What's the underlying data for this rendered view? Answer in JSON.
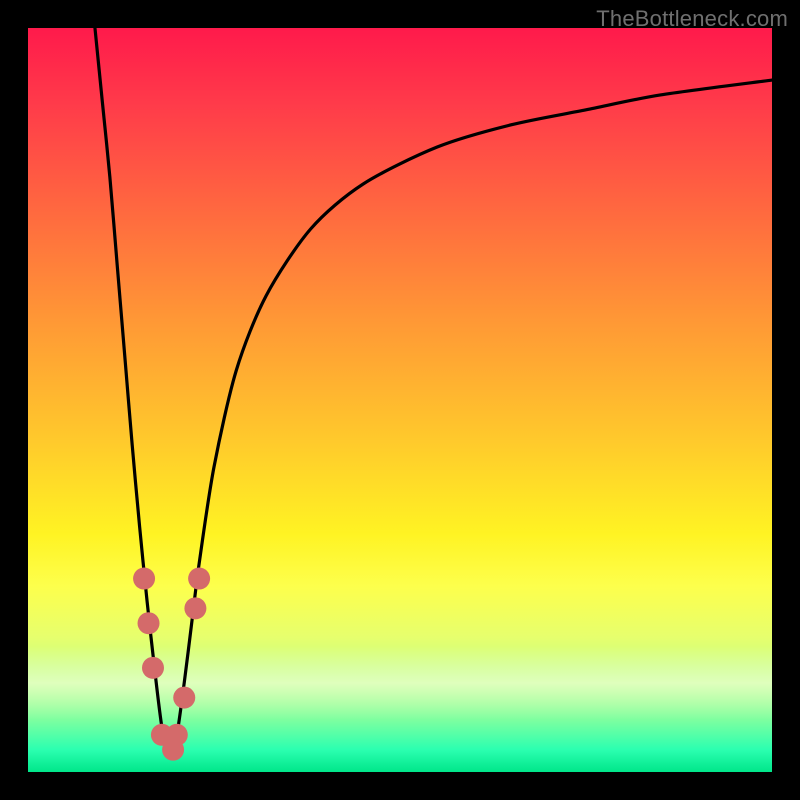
{
  "watermark": "TheBottleneck.com",
  "colors": {
    "curve_stroke": "#000000",
    "marker_fill": "#d46a6a",
    "marker_stroke": "#b24f4f"
  },
  "chart_data": {
    "type": "line",
    "title": "",
    "xlabel": "",
    "ylabel": "",
    "xlim": [
      0,
      100
    ],
    "ylim": [
      0,
      100
    ],
    "markers": [
      {
        "x": 15.6,
        "y": 26
      },
      {
        "x": 16.2,
        "y": 20
      },
      {
        "x": 16.8,
        "y": 14
      },
      {
        "x": 18.0,
        "y": 5
      },
      {
        "x": 19.5,
        "y": 3
      },
      {
        "x": 20.0,
        "y": 5
      },
      {
        "x": 21.0,
        "y": 10
      },
      {
        "x": 22.5,
        "y": 22
      },
      {
        "x": 23.0,
        "y": 26
      }
    ],
    "curve_note": "V-shaped dip with minimum near x≈19, left branch rises to 100 at x≈9, right branch rises asymptotically toward ~93 by x=100",
    "series": [
      {
        "name": "bottleneck-curve",
        "x": [
          9,
          10,
          11,
          12,
          13,
          14,
          15,
          16,
          17,
          18,
          19,
          20,
          21,
          22,
          23,
          25,
          28,
          32,
          38,
          45,
          55,
          65,
          75,
          85,
          100
        ],
        "y": [
          100,
          90,
          80,
          68,
          56,
          44,
          33,
          23,
          14,
          6,
          2,
          5,
          12,
          20,
          28,
          41,
          54,
          64,
          73,
          79,
          84,
          87,
          89,
          91,
          93
        ]
      }
    ]
  }
}
